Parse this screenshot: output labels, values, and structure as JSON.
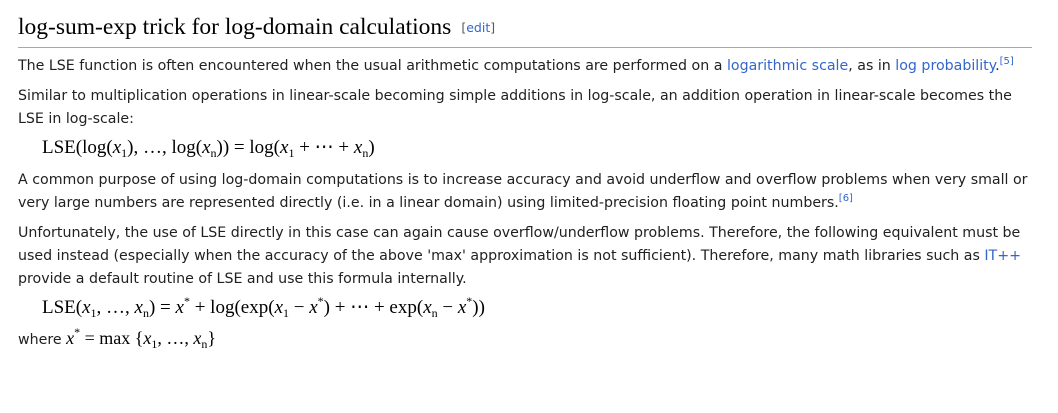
{
  "section": {
    "title": "log-sum-exp trick for log-domain calculations",
    "edit_open": "[",
    "edit_label": "edit",
    "edit_close": "]"
  },
  "p1": {
    "text_a": "The LSE function is often encountered when the usual arithmetic computations are performed on a ",
    "link_logscale": "logarithmic scale",
    "text_b": ", as in ",
    "link_logprob": "log probability",
    "text_c": ".",
    "ref": "[5]"
  },
  "p2": {
    "text": "Similar to multiplication operations in linear-scale becoming simple additions in log-scale, an addition operation in linear-scale becomes the LSE in log-scale:"
  },
  "eq1": {
    "lse": "LSE",
    "open": "(log(",
    "x1": "x",
    "sub1": "1",
    "mid": "), …, log(",
    "xn": "x",
    "subn": "n",
    "close": ")) = log(",
    "x1b": "x",
    "sub1b": "1",
    "plus": " + ⋯ + ",
    "xnb": "x",
    "subnb": "n",
    "end": ")"
  },
  "p3": {
    "text": "A common purpose of using log-domain computations is to increase accuracy and avoid underflow and overflow problems when very small or very large numbers are represented directly (i.e. in a linear domain) using limited-precision floating point numbers.",
    "ref": "[6]"
  },
  "p4": {
    "text_a": "Unfortunately, the use of LSE directly in this case can again cause overflow/underflow problems. Therefore, the following equivalent must be used instead (especially when the accuracy of the above 'max' approximation is not sufficient). Therefore, many math libraries such as ",
    "link_itpp": "IT++",
    "text_b": " provide a default routine of LSE and use this formula internally."
  },
  "eq2": {
    "lse": "LSE",
    "open": "(",
    "x1": "x",
    "sub1": "1",
    "mid": ", …, ",
    "xn": "x",
    "subn": "n",
    "eq": ") = ",
    "xs": "x",
    "star": "*",
    "log_open": " + log(exp(",
    "x1b": "x",
    "sub1b": "1",
    "minus1": " − ",
    "xs2": "x",
    "star2": "*",
    "mid2": ") + ⋯ + exp(",
    "xnb": "x",
    "subnb": "n",
    "minus2": " − ",
    "xs3": "x",
    "star3": "*",
    "end": "))"
  },
  "where": {
    "label": "where ",
    "xs": "x",
    "star": "*",
    "eq": " = max {",
    "x1": "x",
    "sub1": "1",
    "mid": ", …, ",
    "xn": "x",
    "subn": "n",
    "end": "}"
  }
}
